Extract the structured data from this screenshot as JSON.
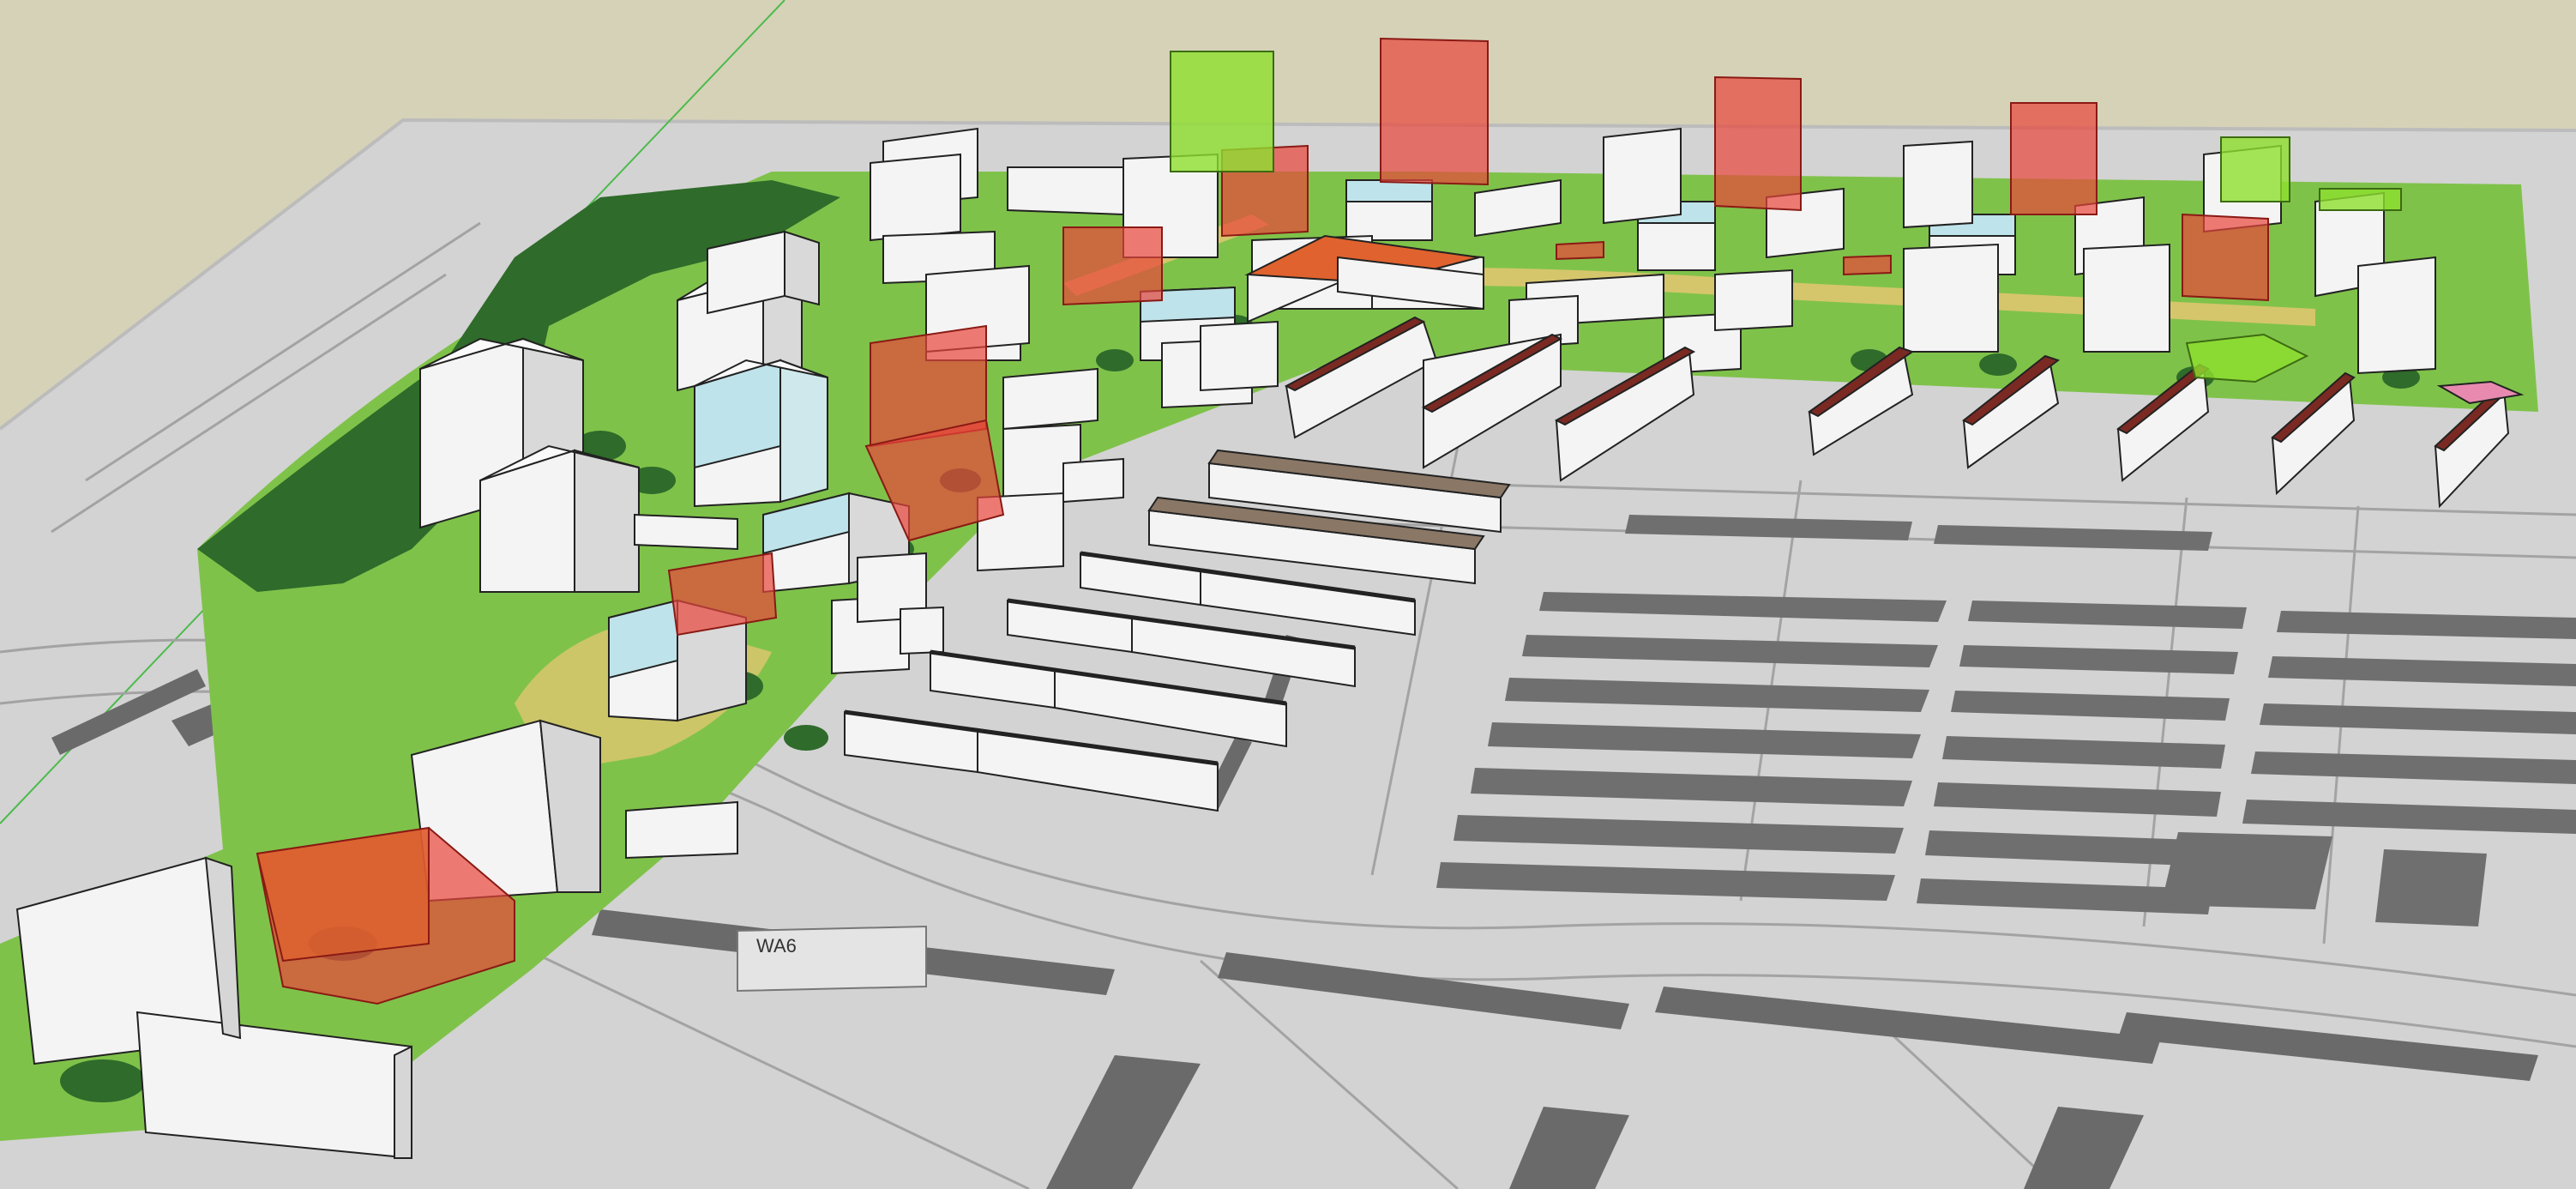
{
  "scene": {
    "site_label": {
      "code": "WA6"
    },
    "colors": {
      "sky": "#d6d2b8",
      "ground": "#d2d2d2",
      "map_lines": "#9a9a9a",
      "map_blocks": "#6e6e6e",
      "park_green": "#7fc24a",
      "dark_tree": "#2f6b2a",
      "path_yellow": "#d8c86a",
      "building_white": "#f4f4f4",
      "building_side": "#d9d9d9",
      "glass_blue": "#bfe3ea",
      "highlight_red": "#e8453b",
      "highlight_orange": "#e0622e",
      "highlight_green": "#8fe02e",
      "roof_brown": "#7a2a22",
      "roof_tan": "#8a7766"
    }
  }
}
